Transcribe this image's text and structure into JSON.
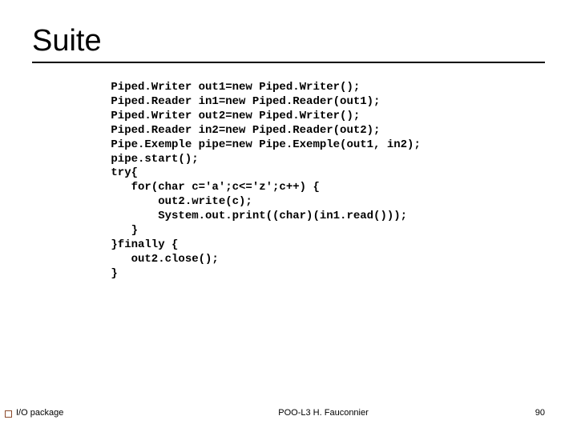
{
  "slide": {
    "title": "Suite",
    "code": " Piped.Writer out1=new Piped.Writer();\n Piped.Reader in1=new Piped.Reader(out1);\n Piped.Writer out2=new Piped.Writer();\n Piped.Reader in2=new Piped.Reader(out2);\n Pipe.Exemple pipe=new Pipe.Exemple(out1, in2);\n pipe.start();\n try{\n    for(char c='a';c<='z';c++) {\n        out2.write(c);\n        System.out.print((char)(in1.read()));\n    }\n }finally {\n    out2.close();\n }"
  },
  "footer": {
    "left": "I/O package",
    "center": "POO-L3 H. Fauconnier",
    "page": "90"
  }
}
